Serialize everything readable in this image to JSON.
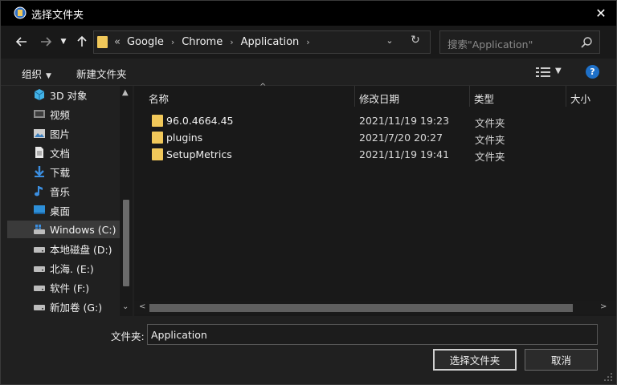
{
  "window": {
    "title": "选择文件夹"
  },
  "address": {
    "overflow": "«",
    "crumbs": [
      "Google",
      "Chrome",
      "Application"
    ]
  },
  "search": {
    "placeholder": "搜索\"Application\""
  },
  "toolbar": {
    "organize": "组织",
    "new_folder": "新建文件夹",
    "help": "?"
  },
  "sidebar": {
    "items": [
      {
        "label": "3D 对象",
        "icon": "3d-objects-icon"
      },
      {
        "label": "视频",
        "icon": "videos-icon"
      },
      {
        "label": "图片",
        "icon": "pictures-icon"
      },
      {
        "label": "文档",
        "icon": "documents-icon"
      },
      {
        "label": "下载",
        "icon": "downloads-icon"
      },
      {
        "label": "音乐",
        "icon": "music-icon"
      },
      {
        "label": "桌面",
        "icon": "desktop-icon"
      },
      {
        "label": "Windows (C:)",
        "icon": "drive-windows-icon",
        "selected": true
      },
      {
        "label": "本地磁盘 (D:)",
        "icon": "drive-icon"
      },
      {
        "label": "北海. (E:)",
        "icon": "drive-icon"
      },
      {
        "label": "软件 (F:)",
        "icon": "drive-icon"
      },
      {
        "label": "新加卷 (G:)",
        "icon": "drive-icon"
      }
    ]
  },
  "columns": {
    "name": "名称",
    "date": "修改日期",
    "type": "类型",
    "size": "大小"
  },
  "files": [
    {
      "name": "96.0.4664.45",
      "date": "2021/11/19 19:23",
      "type": "文件夹"
    },
    {
      "name": "plugins",
      "date": "2021/7/20 20:27",
      "type": "文件夹"
    },
    {
      "name": "SetupMetrics",
      "date": "2021/11/19 19:41",
      "type": "文件夹"
    }
  ],
  "bottom": {
    "filename_label": "文件夹:",
    "filename_value": "Application",
    "select_button": "选择文件夹",
    "cancel_button": "取消"
  },
  "colors": {
    "folder": "#f1c85a",
    "accent": "#1e70c8",
    "background": "#202020"
  }
}
